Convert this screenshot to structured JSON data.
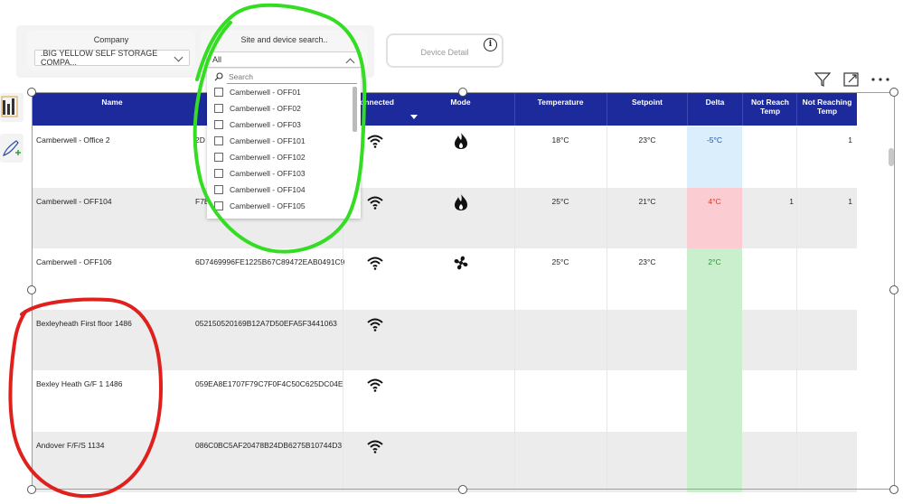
{
  "slicers": {
    "company": {
      "title": "Company",
      "value": ".BIG YELLOW SELF STORAGE COMPA..."
    },
    "site": {
      "title": "Site and device search..",
      "value": "All",
      "search_placeholder": "Search",
      "options": [
        "Camberwell - OFF01",
        "Camberwell - OFF02",
        "Camberwell - OFF03",
        "Camberwell - OFF101",
        "Camberwell - OFF102",
        "Camberwell - OFF103",
        "Camberwell - OFF104",
        "Camberwell - OFF105"
      ]
    }
  },
  "device_detail": {
    "label": "Device Detail",
    "info": "i"
  },
  "table": {
    "headers": {
      "name": "Name",
      "id": "",
      "connected": "Connected",
      "mode": "Mode",
      "temperature": "Temperature",
      "setpoint": "Setpoint",
      "delta": "Delta",
      "not_reach_1": "Not Reach",
      "not_reach_2": "Temp",
      "not_reaching_1": "Not Reaching",
      "not_reaching_2": "Temp"
    },
    "rows": [
      {
        "name": "Camberwell - Office 2",
        "id": "2D",
        "mode_icon": "flame-icon",
        "temperature": "18°C",
        "setpoint": "23°C",
        "delta": "-5°C",
        "delta_color": "#daeefc",
        "delta_text": "#1f4fb4",
        "not_reach": "",
        "not_reaching": "1",
        "bg": "#ffffff"
      },
      {
        "name": "Camberwell - OFF104",
        "id": "F7E",
        "mode_icon": "flame-icon",
        "temperature": "25°C",
        "setpoint": "21°C",
        "delta": "4°C",
        "delta_color": "#fbccd1",
        "delta_text": "#d9382f",
        "not_reach": "1",
        "not_reaching": "1",
        "bg": "#ececec"
      },
      {
        "name": "Camberwell - OFF106",
        "id": "6D7469996FE1225B67C89472EAB0491C9",
        "mode_icon": "fan-icon",
        "temperature": "25°C",
        "setpoint": "23°C",
        "delta": "2°C",
        "delta_color": "#c9efcc",
        "delta_text": "#2e8b3a",
        "not_reach": "",
        "not_reaching": "",
        "bg": "#ffffff"
      },
      {
        "name": "Bexleyheath First floor 1486",
        "id": "052150520169B12A7D50EFA5F3441063",
        "mode_icon": "",
        "temperature": "",
        "setpoint": "",
        "delta": "",
        "delta_color": "#c9efcc",
        "delta_text": "#2e8b3a",
        "not_reach": "",
        "not_reaching": "",
        "bg": "#ececec"
      },
      {
        "name": "Bexley Heath G/F 1 1486",
        "id": "059EA8E1707F79C7F0F4C50C625DC04E",
        "mode_icon": "",
        "temperature": "",
        "setpoint": "",
        "delta": "",
        "delta_color": "#c9efcc",
        "delta_text": "#2e8b3a",
        "not_reach": "",
        "not_reaching": "",
        "bg": "#ffffff"
      },
      {
        "name": "Andover F/F/S 1134",
        "id": "086C0BC5AF20478B24DB6275B10744D3",
        "mode_icon": "",
        "temperature": "",
        "setpoint": "",
        "delta": "",
        "delta_color": "#c9efcc",
        "delta_text": "#2e8b3a",
        "not_reach": "",
        "not_reaching": "",
        "bg": "#ececec"
      }
    ]
  },
  "colors": {
    "header": "#1c2a9c",
    "annotation_green": "#33dd22",
    "annotation_red": "#e0201c"
  }
}
